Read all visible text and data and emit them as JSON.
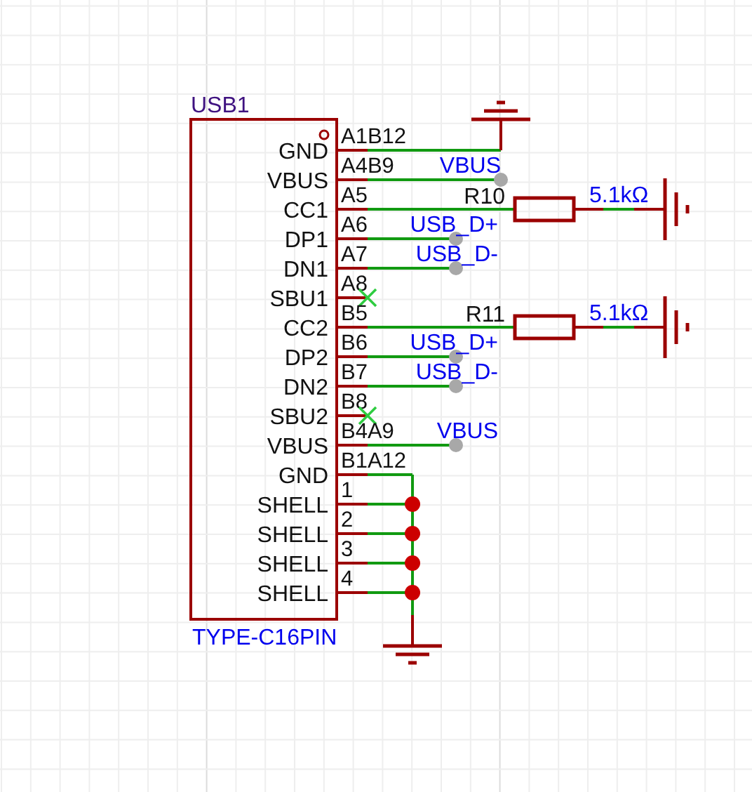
{
  "component": {
    "designator": "USB1",
    "value": "TYPE-C16PIN",
    "pins": [
      {
        "name": "GND",
        "number": "A1B12",
        "kind": "ground"
      },
      {
        "name": "VBUS",
        "number": "A4B9",
        "kind": "net_label",
        "label": "VBUS"
      },
      {
        "name": "CC1",
        "number": "A5",
        "kind": "resistor",
        "resistor": {
          "designator": "R10",
          "value": "5.1kΩ"
        }
      },
      {
        "name": "DP1",
        "number": "A6",
        "kind": "net_label",
        "label": "USB_D+"
      },
      {
        "name": "DN1",
        "number": "A7",
        "kind": "net_label",
        "label": "USB_D-"
      },
      {
        "name": "SBU1",
        "number": "A8",
        "kind": "no_connect"
      },
      {
        "name": "CC2",
        "number": "B5",
        "kind": "resistor",
        "resistor": {
          "designator": "R11",
          "value": "5.1kΩ"
        }
      },
      {
        "name": "DP2",
        "number": "B6",
        "kind": "net_label",
        "label": "USB_D+"
      },
      {
        "name": "DN2",
        "number": "B7",
        "kind": "net_label",
        "label": "USB_D-"
      },
      {
        "name": "SBU2",
        "number": "B8",
        "kind": "no_connect"
      },
      {
        "name": "VBUS",
        "number": "B4A9",
        "kind": "net_label",
        "label": "VBUS"
      },
      {
        "name": "GND",
        "number": "B1A12",
        "kind": "ground_bus"
      },
      {
        "name": "SHELL",
        "number": "1",
        "kind": "shell"
      },
      {
        "name": "SHELL",
        "number": "2",
        "kind": "shell"
      },
      {
        "name": "SHELL",
        "number": "3",
        "kind": "shell"
      },
      {
        "name": "SHELL",
        "number": "4",
        "kind": "shell"
      }
    ]
  }
}
